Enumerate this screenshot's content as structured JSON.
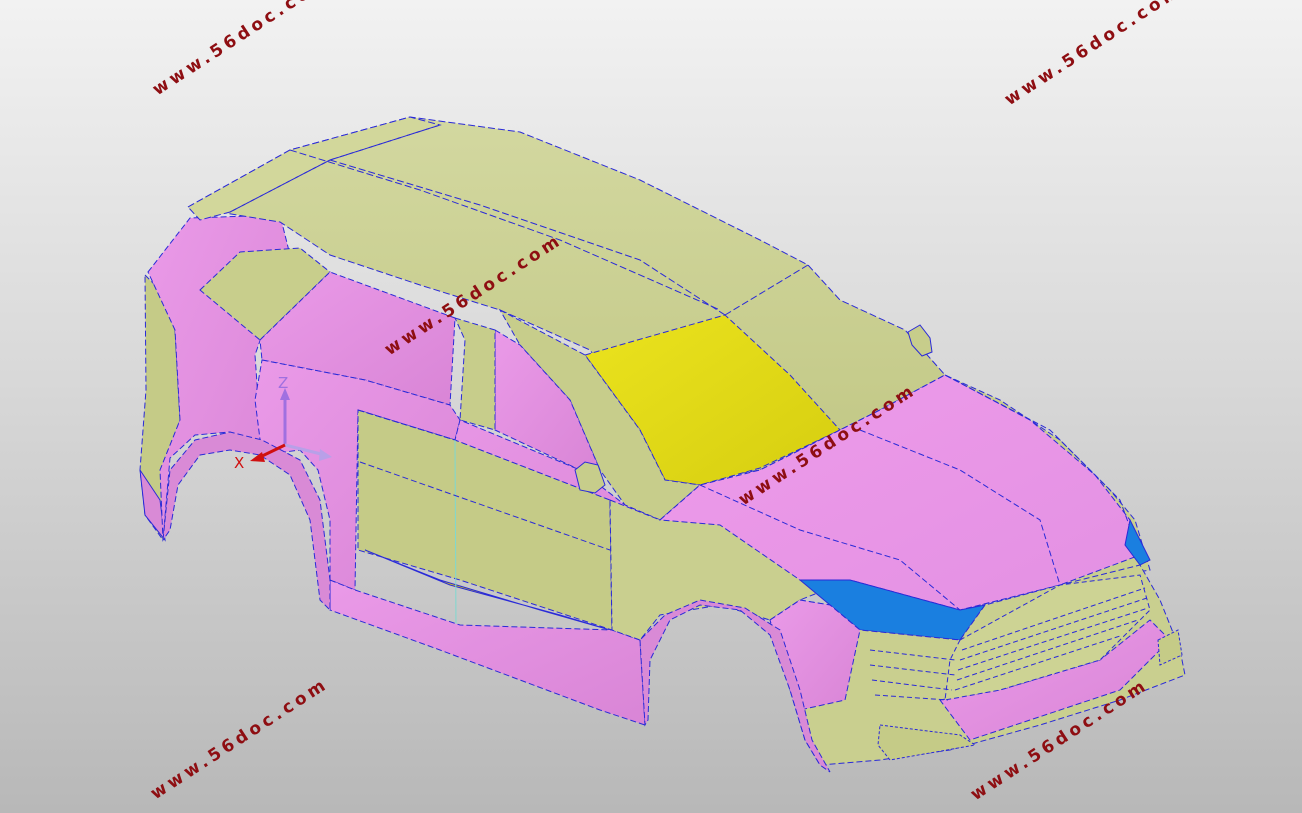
{
  "viewport": {
    "background_top": "#f2f2f2",
    "background_bottom": "#b8b8b8"
  },
  "watermarks": [
    "www.56doc.com",
    "www.56doc.com",
    "www.56doc.com",
    "www.56doc.com",
    "www.56doc.com",
    "www.56doc.com"
  ],
  "axes": {
    "x_label": "X",
    "z_label": "Z",
    "x_color": "#d01010",
    "z_color": "#a070e0"
  },
  "model": {
    "name": "car-body-surface-model",
    "colors": {
      "khaki_surface": "#c9cf8f",
      "pink_surface": "#e68fe4",
      "windshield_yellow": "#e4dc18",
      "blue_headlight": "#1a7fe0",
      "edge_blue": "#2a2ad8"
    }
  }
}
